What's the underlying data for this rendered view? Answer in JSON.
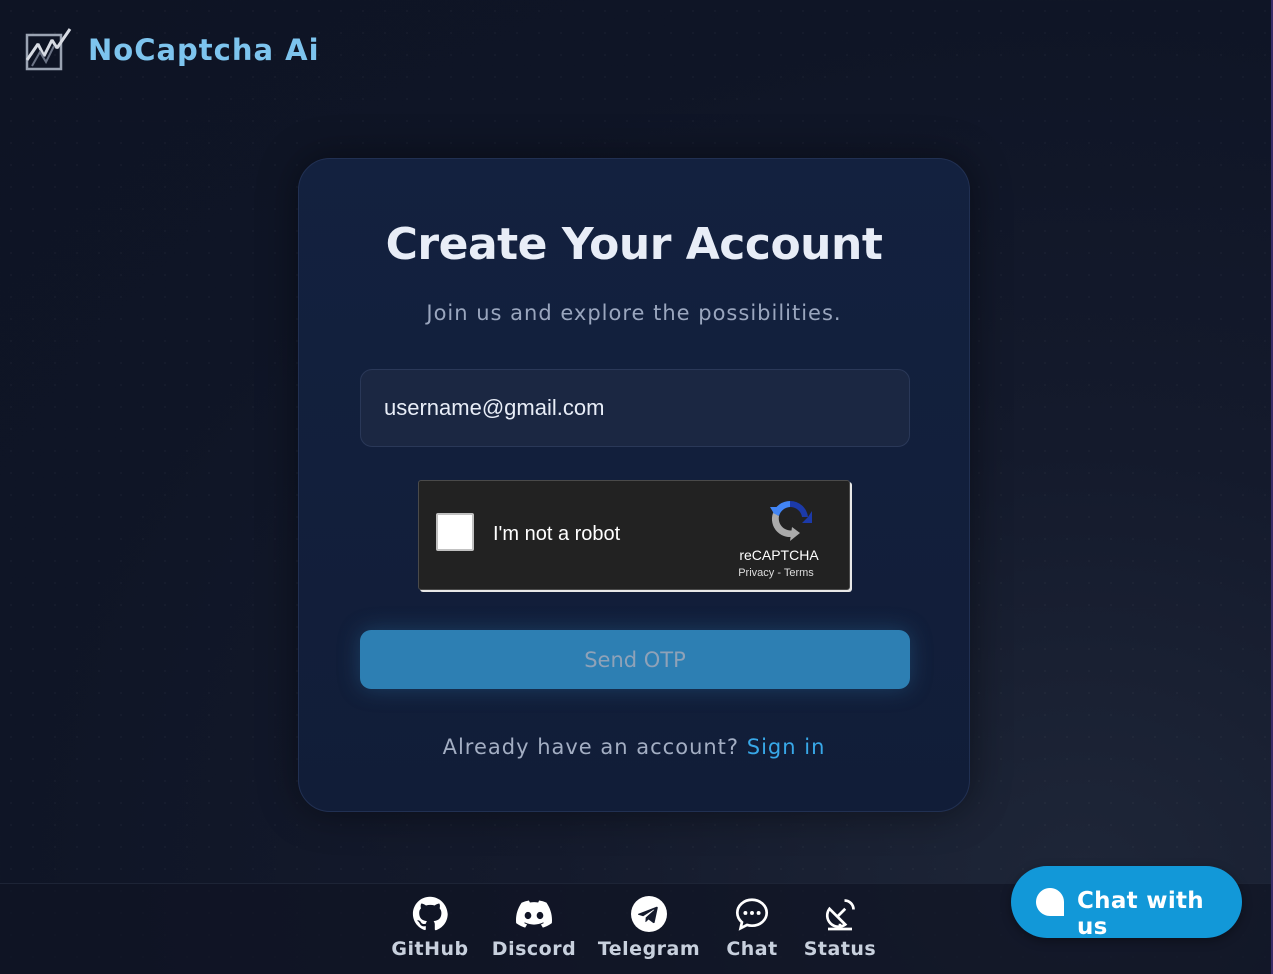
{
  "brand": {
    "name": "NoCaptcha Ai",
    "logo_icon": "nocaptcha-logo-icon"
  },
  "card": {
    "title": "Create Your Account",
    "subtitle": "Join us and explore the possibilities.",
    "email_value": "username@gmail.com",
    "send_button": "Send OTP",
    "signin_prompt": "Already have an account?",
    "signin_link": "Sign in"
  },
  "recaptcha": {
    "label": "I'm not a robot",
    "brand": "reCAPTCHA",
    "privacy": "Privacy",
    "separator": " - ",
    "terms": "Terms",
    "checked": false
  },
  "footer": {
    "links": [
      {
        "label": "GitHub",
        "icon": "github-icon"
      },
      {
        "label": "Discord",
        "icon": "discord-icon"
      },
      {
        "label": "Telegram",
        "icon": "telegram-icon"
      },
      {
        "label": "Chat",
        "icon": "chat-icon"
      },
      {
        "label": "Status",
        "icon": "status-icon"
      }
    ]
  },
  "chat_widget": {
    "label": "Chat with us",
    "icon": "chat-bubble-icon"
  },
  "colors": {
    "accent": "#38a8e8",
    "brand": "#7dc4ee",
    "button": "#2d7fb3",
    "chat_widget": "#1298d8"
  }
}
